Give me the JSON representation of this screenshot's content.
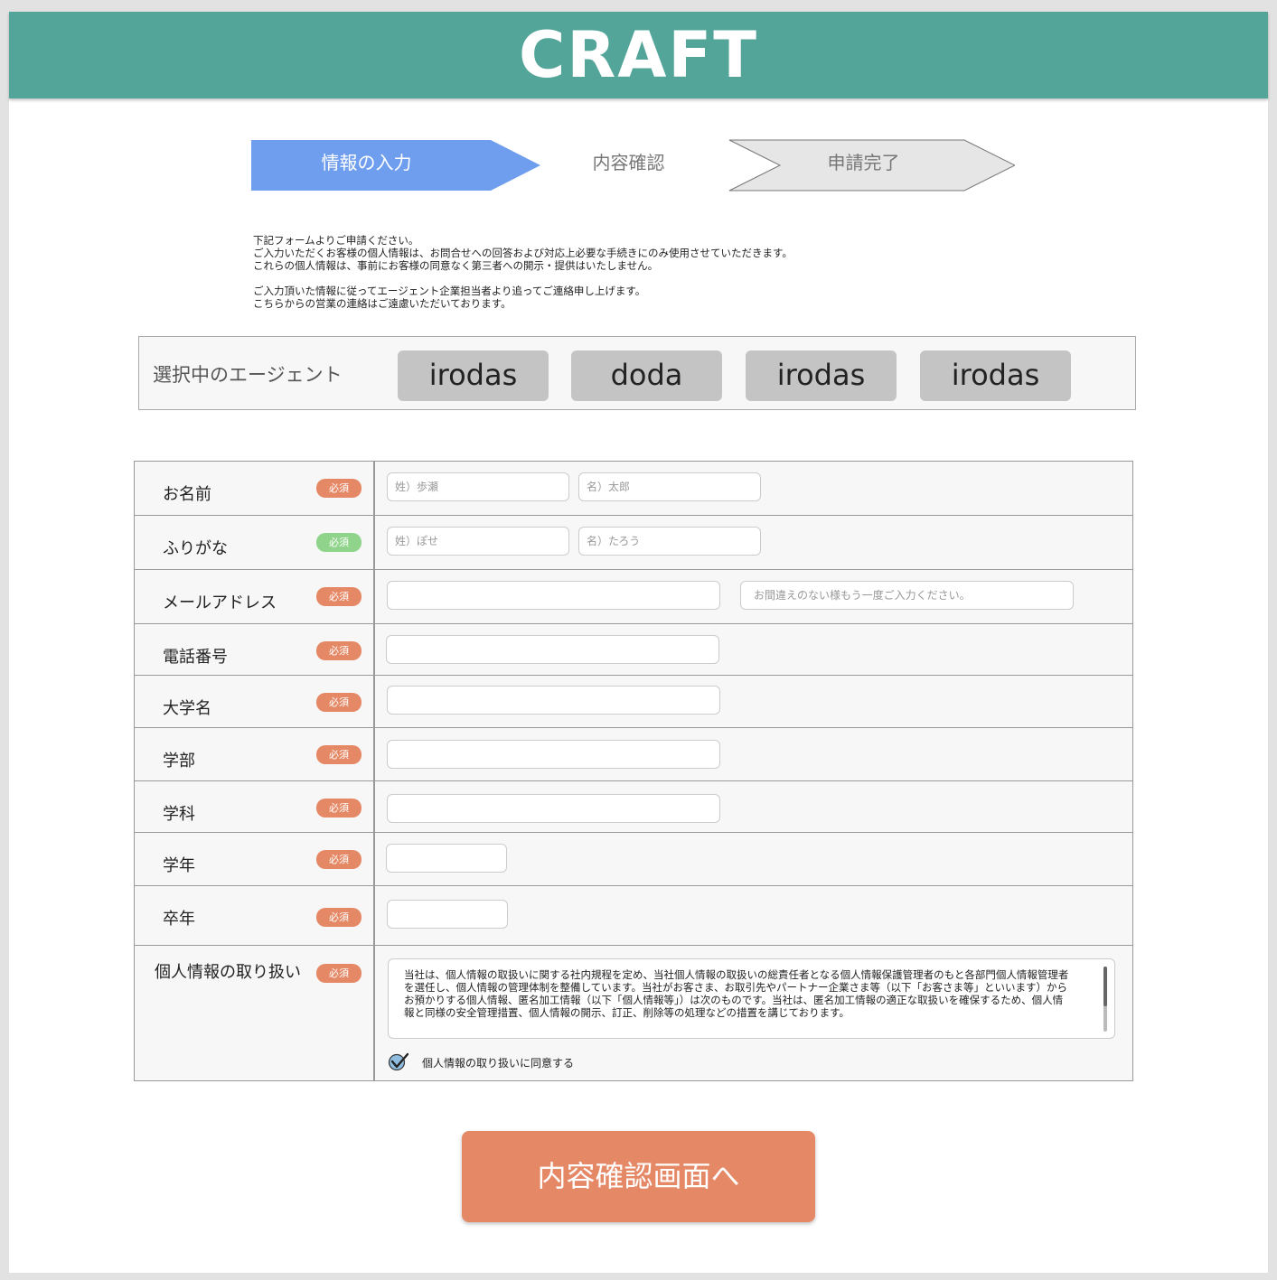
{
  "header": {
    "logo": "CRAFT"
  },
  "steps": [
    {
      "label": "情報の入力",
      "active": true
    },
    {
      "label": "内容確認",
      "active": false
    },
    {
      "label": "申請完了",
      "active": false
    }
  ],
  "intro": {
    "lines_1": [
      "下記フォームよりご申請ください。",
      "ご入力いただくお客様の個人情報は、お問合せへの回答および対応上必要な手続きにのみ使用させていただきます。",
      "これらの個人情報は、事前にお客様の同意なく第三者への開示・提供はいたしません。"
    ],
    "lines_2": [
      "ご入力頂いた情報に従ってエージェント企業担当者より追ってご連絡申し上げます。",
      "こちらからの営業の連絡はご遠慮いただいております。"
    ]
  },
  "agents": {
    "label": "選択中のエージェント",
    "items": [
      "irodas",
      "doda",
      "irodas",
      "irodas"
    ]
  },
  "form": {
    "required_label": "必須",
    "name": {
      "label": "お名前",
      "last_placeholder": "姓）歩瀬",
      "first_placeholder": "名）太郎"
    },
    "furigana": {
      "label": "ふりがな",
      "last_placeholder": "姓）ぽせ",
      "first_placeholder": "名）たろう"
    },
    "email": {
      "label": "メールアドレス",
      "value": "",
      "confirm_placeholder": "お間違えのない様もう一度ご入力ください。"
    },
    "phone": {
      "label": "電話番号",
      "value": ""
    },
    "university": {
      "label": "大学名",
      "value": ""
    },
    "faculty": {
      "label": "学部",
      "value": ""
    },
    "department": {
      "label": "学科",
      "value": ""
    },
    "year": {
      "label": "学年",
      "value": ""
    },
    "grad_year": {
      "label": "卒年",
      "value": ""
    },
    "privacy": {
      "label": "個人情報の取り扱い",
      "text": "当社は、個人情報の取扱いに関する社内規程を定め、当社個人情報の取扱いの総責任者となる個人情報保護管理者のもと各部門個人情報管理者を選任し、個人情報の管理体制を整備しています。当社がお客さま、お取引先やパートナー企業さま等（以下「お客さま等」といいます）からお預かりする個人情報、匿名加工情報（以下「個人情報等」）は次のものです。当社は、匿名加工情報の適正な取扱いを確保するため、個人情報と同様の安全管理措置、個人情報の開示、訂正、削除等の処理などの措置を講じております。",
      "consent_label": "個人情報の取り扱いに同意する",
      "consent_checked": true
    }
  },
  "submit": {
    "label": "内容確認画面へ"
  },
  "colors": {
    "header": "#53a59a",
    "step_active": "#6f9eee",
    "step_inactive": "#e6e6e6",
    "required_badge": "#e58866",
    "optional_badge": "#8fd48a",
    "submit": "#e58866"
  }
}
